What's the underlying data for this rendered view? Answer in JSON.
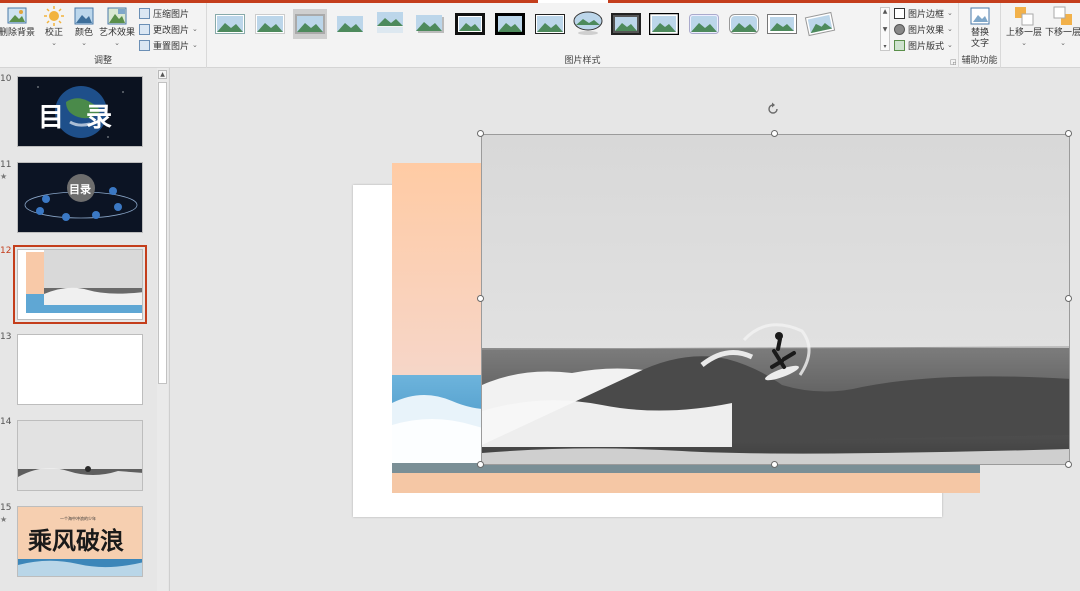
{
  "ribbon": {
    "adjust": {
      "remove_bg": "删除背景",
      "corrections": "校正",
      "color": "颜色",
      "artistic": "艺术效果",
      "compress": "压缩图片",
      "change": "更改图片",
      "reset": "重置图片",
      "group_label": "调整"
    },
    "styles": {
      "group_label": "图片样式",
      "border": "图片边框",
      "effects": "图片效果",
      "layout": "图片版式"
    },
    "accessibility": {
      "alt_text_line1": "替换",
      "alt_text_line2": "文字",
      "group_label": "辅助功能"
    },
    "arrange": {
      "bring_forward": "上移一层",
      "send_backward": "下移一层"
    }
  },
  "slides": [
    {
      "number": "10",
      "kind": "earth-title",
      "title": "目录"
    },
    {
      "number": "11",
      "star": "★",
      "kind": "toc",
      "title": "目录"
    },
    {
      "number": "12",
      "kind": "surf-peach",
      "selected": true
    },
    {
      "number": "13",
      "kind": "blank"
    },
    {
      "number": "14",
      "kind": "surf-grey"
    },
    {
      "number": "15",
      "star": "★",
      "kind": "calligraphy",
      "title": "乘风破浪",
      "subtitle": "一个海中冲浪的少年"
    }
  ],
  "colors": {
    "accent": "#c43e1c",
    "ribbon_bg": "#f3f3f3",
    "canvas_bg": "#e6e6e6",
    "peach": "#f8c9a8"
  }
}
